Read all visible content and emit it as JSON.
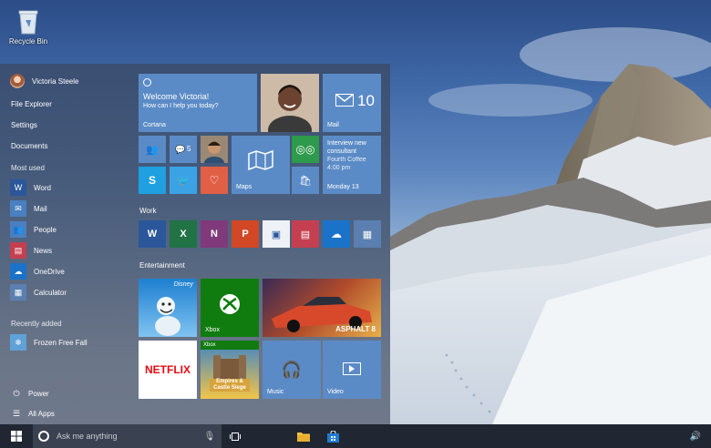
{
  "desktop": {
    "recycle_bin_label": "Recycle Bin"
  },
  "start_menu": {
    "user_name": "Victoria Steele",
    "nav": [
      "File Explorer",
      "Settings",
      "Documents"
    ],
    "most_used_label": "Most used",
    "most_used": [
      {
        "label": "Word",
        "icon": "word-icon",
        "color": "#2b579a"
      },
      {
        "label": "Mail",
        "icon": "mail-icon",
        "color": "#4a7fc1"
      },
      {
        "label": "People",
        "icon": "people-icon",
        "color": "#4a7fc1"
      },
      {
        "label": "News",
        "icon": "news-icon",
        "color": "#c43f4f"
      },
      {
        "label": "OneDrive",
        "icon": "onedrive-icon",
        "color": "#1a73c8"
      },
      {
        "label": "Calculator",
        "icon": "calculator-icon",
        "color": "#5a7fb0"
      }
    ],
    "recently_added_label": "Recently added",
    "recently_added": [
      {
        "label": "Frozen Free Fall",
        "icon": "frozen-free-fall-icon"
      }
    ],
    "power_label": "Power",
    "all_apps_label": "All Apps"
  },
  "tiles": {
    "cortana": {
      "title": "Welcome Victoria!",
      "subtitle": "How can I help you today?",
      "label": "Cortana"
    },
    "mail": {
      "label": "Mail",
      "count": "10"
    },
    "messaging_count": "5",
    "calendar": {
      "line1": "Interview new",
      "line2": "consultant",
      "line3": "Fourth Coffee",
      "line4": "4:00 pm",
      "day": "Monday 13"
    },
    "maps_label": "Maps",
    "work_label": "Work",
    "entertainment_label": "Entertainment",
    "disney_label": "Disney",
    "xbox_label": "Xbox",
    "xbox_badge": "Xbox",
    "asphalt_label": "ASPHALT 8",
    "netflix_label": "NETFLIX",
    "empires_label": "Empires & Castle Siege",
    "music_label": "Music",
    "video_label": "Video"
  },
  "taskbar": {
    "search_placeholder": "Ask me anything"
  },
  "colors": {
    "tile_blue": "#5b8bc6",
    "accent": "#4a7fc1",
    "taskbar": "#202632"
  }
}
